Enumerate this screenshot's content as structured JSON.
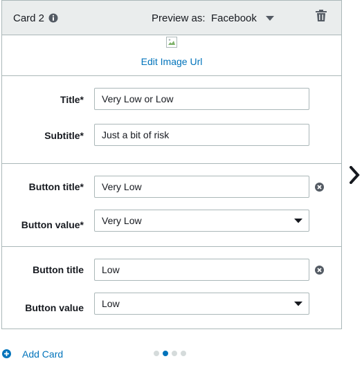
{
  "card": {
    "title": "Card 2",
    "preview_label": "Preview as:",
    "preview_value": "Facebook",
    "edit_image_label": "Edit Image Url"
  },
  "fields": {
    "title_label": "Title*",
    "title_value": "Very Low or Low",
    "subtitle_label": "Subtitle*",
    "subtitle_value": "Just a bit of risk"
  },
  "buttons": [
    {
      "title_label": "Button title*",
      "title_value": "Very Low",
      "value_label": "Button value*",
      "value_selected": "Very Low"
    },
    {
      "title_label": "Button title",
      "title_value": "Low",
      "value_label": "Button value",
      "value_selected": "Low"
    }
  ],
  "footer": {
    "add_card_label": "Add Card",
    "pagination": {
      "total": 4,
      "active_index": 1
    }
  },
  "colors": {
    "link": "#0073bb",
    "header_bg": "#eaeded",
    "border": "#aab7b8",
    "icon": "#545b64"
  },
  "icons": [
    "info-icon",
    "caret-down-icon",
    "trash-icon",
    "broken-image-icon",
    "remove-icon",
    "chevron-right-icon",
    "plus-circle-icon"
  ]
}
